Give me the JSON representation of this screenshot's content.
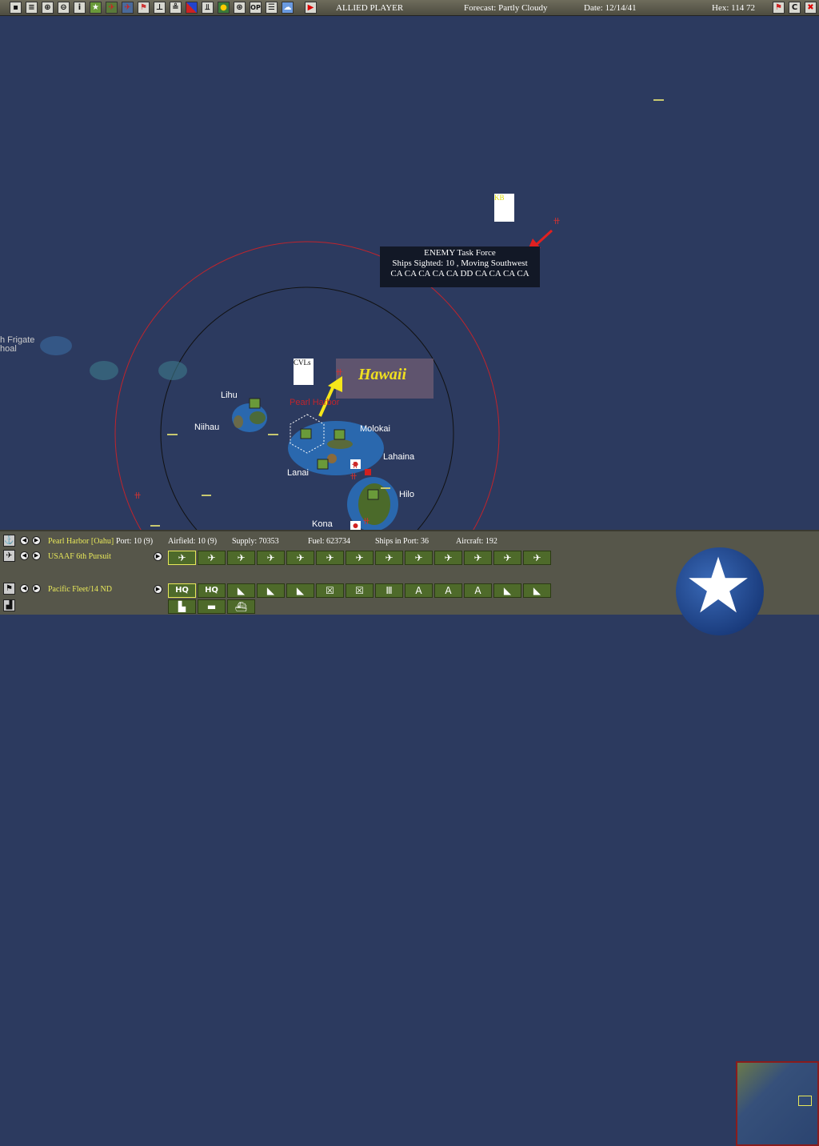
{
  "toolbar": {
    "icons": [
      "save-icon",
      "report-icon",
      "task-force-icon",
      "air-icon",
      "info-icon",
      "base-icon",
      "allied-air-icon",
      "enemy-air-icon",
      "flag-icon",
      "ship-icon",
      "sub-icon",
      "front-icon",
      "convoy-icon",
      "globe-icon",
      "target-icon",
      "op-icon",
      "list-icon",
      "weather-icon"
    ],
    "op_label": "OP",
    "play_icon": "play-icon",
    "player": "ALLIED PLAYER",
    "forecast": "Forecast: Partly Cloudy",
    "date": "Date: 12/14/41",
    "hex": "Hex: 114  72",
    "c_label": "C"
  },
  "map": {
    "labels": {
      "frigate": "h Frigate",
      "shoal": "hoal",
      "lihu": "Lihu",
      "niihau": "Niihau",
      "pearl": "Pearl Harbor",
      "molokai": "Molokai",
      "lahaina": "Lahaina",
      "lanai": "Lanai",
      "hilo": "Hilo",
      "kona": "Kona",
      "hawaii": "Hawaii",
      "cvls": "CVLs",
      "kb": "KB"
    },
    "tooltip": {
      "title": "ENEMY Task Force",
      "line2": "Ships Sighted: 10 , Moving Southwest",
      "line3": "CA CA CA CA CA DD CA CA CA CA"
    }
  },
  "panel": {
    "base": "Pearl Harbor [Oahu]",
    "port": "Port: 10 (9)",
    "airfield": "Airfield: 10 (9)",
    "supply": "Supply: 70353",
    "fuel": "Fuel: 623734",
    "ships": "Ships in Port: 36",
    "aircraft": "Aircraft: 192",
    "air_unit": "USAAF 6th Pursuit",
    "hq_unit": "Pacific Fleet/14 ND",
    "air_buttons": [
      "✈",
      "✈",
      "✈",
      "✈",
      "✈",
      "✈",
      "✈",
      "✈",
      "✈",
      "✈",
      "✈",
      "✈",
      "✈"
    ],
    "unit_buttons": [
      "HQ",
      "HQ",
      "◣",
      "◣",
      "◣",
      "☒",
      "☒",
      "Ⅲ",
      "A",
      "A",
      "A",
      "◣",
      "◣"
    ],
    "facility_buttons": [
      "▙",
      "▬",
      "⛴"
    ]
  }
}
